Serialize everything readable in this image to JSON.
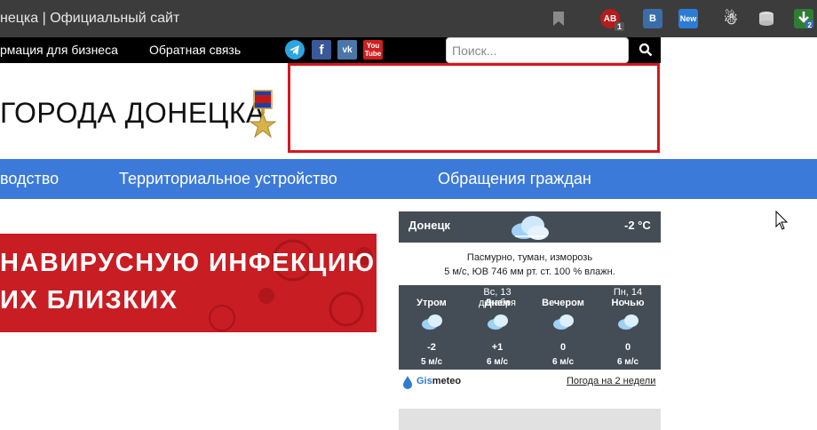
{
  "browser": {
    "tab_title": "нецка | Официальный сайт",
    "extensions": [
      {
        "name": "adblock-icon",
        "text": "AB",
        "badge": "1"
      },
      {
        "name": "vk-extension-icon",
        "text": "B"
      },
      {
        "name": "new-extension-icon",
        "text": "New"
      },
      {
        "name": "santa-extension-icon"
      },
      {
        "name": "database-extension-icon"
      },
      {
        "name": "download-extension-icon",
        "badge": "2"
      }
    ]
  },
  "topbar": {
    "business_label": "рмация для бизнеса",
    "feedback_label": "Обратная связь",
    "social": {
      "telegram": "telegram-icon",
      "facebook": "f",
      "vk": "vk",
      "youtube_top": "You",
      "youtube_bottom": "Tube"
    }
  },
  "search": {
    "placeholder": "Поиск..."
  },
  "header": {
    "title": "ГОРОДА ДОНЕЦКА"
  },
  "nav": {
    "management": "водство",
    "territory": "Территориальное устройство",
    "appeals": "Обращения граждан"
  },
  "banner": {
    "line1": "НАВИРУСНУЮ ИНФЕКЦИЮ",
    "line2": "ИХ БЛИЗКИХ"
  },
  "weather": {
    "city": "Донецк",
    "temperature": "-2 °C",
    "description": "Пасмурно, туман, изморозь",
    "details": "5 м/с, ЮВ  746 мм рт. ст.  100 % влажн.",
    "forecast": [
      {
        "day": "",
        "label": "Утром",
        "temp": "-2",
        "wind": "5 м/с"
      },
      {
        "day": "Вс, 13 декабря",
        "label": "Днем",
        "temp": "+1",
        "wind": "6 м/с"
      },
      {
        "day": "",
        "label": "Вечером",
        "temp": "0",
        "wind": "6 м/с"
      },
      {
        "day": "Пн, 14",
        "label": "Ночью",
        "temp": "0",
        "wind": "6 м/с"
      }
    ],
    "provider_prefix": "Gis",
    "provider_suffix": "meteo",
    "two_weeks_link": "Погода на 2 недели"
  },
  "colors": {
    "nav_blue": "#3c7ad9",
    "banner_red": "#c81d23",
    "ad_border": "#d4181f",
    "weather_bg": "#444d55"
  }
}
